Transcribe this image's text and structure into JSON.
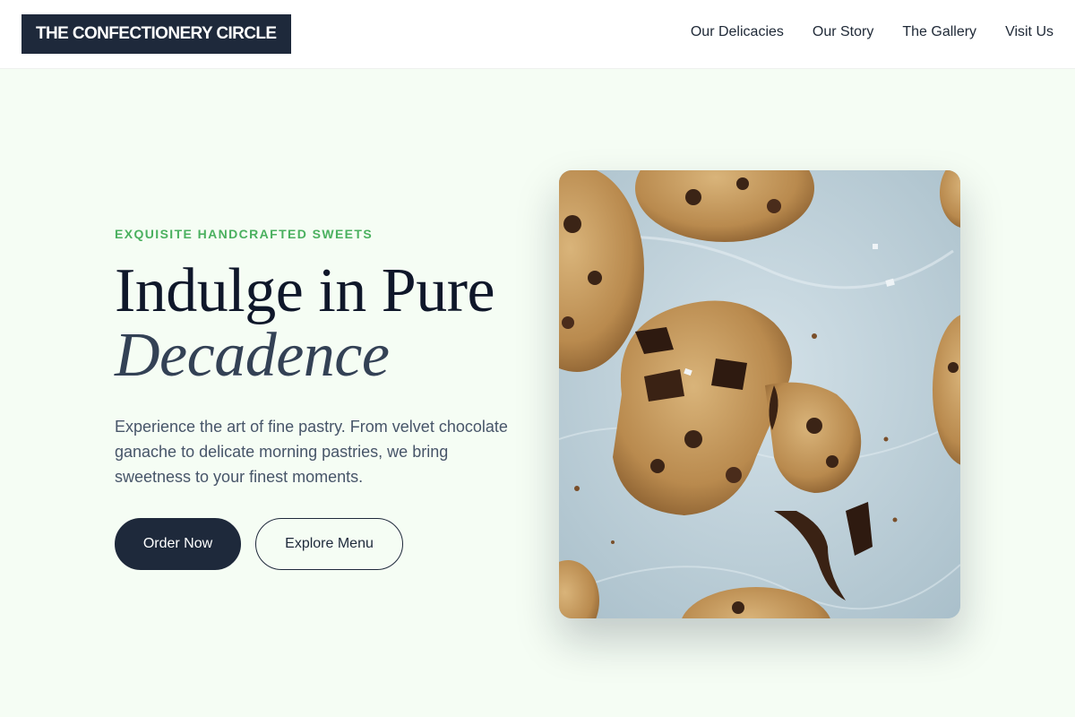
{
  "header": {
    "logo_text": "THE CONFECTIONERY CIRCLE",
    "nav": [
      {
        "label": "Our Delicacies"
      },
      {
        "label": "Our Story"
      },
      {
        "label": "The Gallery"
      },
      {
        "label": "Visit Us"
      }
    ]
  },
  "hero": {
    "eyebrow": "EXQUISITE HANDCRAFTED SWEETS",
    "headline_line1": "Indulge in Pure",
    "headline_line2": "Decadence",
    "description": "Experience the art of fine pastry. From velvet chocolate ganache to delicate morning pastries, we bring sweetness to your finest moments.",
    "primary_button": "Order Now",
    "secondary_button": "Explore Menu",
    "image_subject": "chocolate-chip-cookies-photo"
  },
  "colors": {
    "accent_green": "#4ab05f",
    "dark_navy": "#1e293b",
    "page_background": "#f5fdf4"
  }
}
